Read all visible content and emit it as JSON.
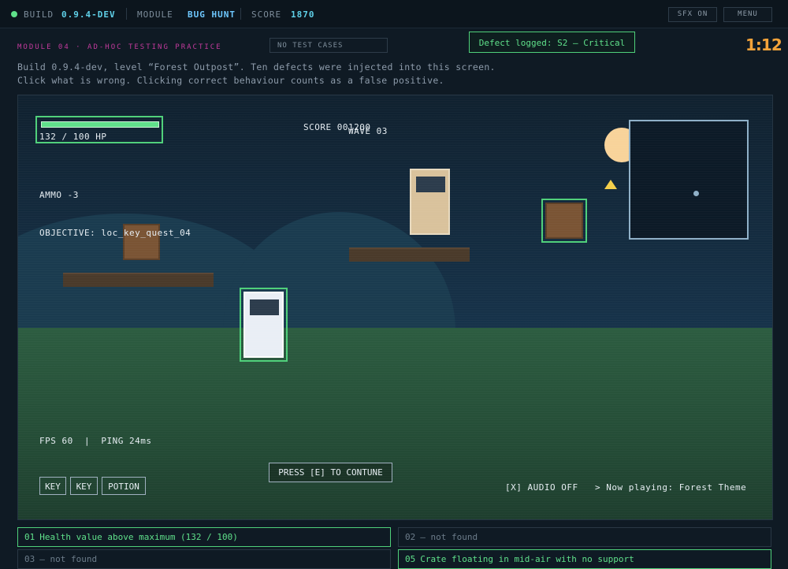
{
  "topbar": {
    "build_label": "BUILD",
    "build_value": "0.9.4-DEV",
    "module_label": "MODULE",
    "module_value": "BUG HUNT",
    "score_label": "SCORE",
    "score_value": "1870",
    "sfx_button": "SFX ON",
    "menu_button": "MENU"
  },
  "header": {
    "module_title": "MODULE 04 · AD-HOC TESTING PRACTICE",
    "test_cases": "NO TEST CASES",
    "toast": "Defect logged: S2 — Critical",
    "timer": "1:12",
    "desc_line1": "Build 0.9.4-dev, level “Forest Outpost”. Ten defects were injected into this screen.",
    "desc_line2": "Click what is wrong. Clicking correct behaviour counts as a false positive."
  },
  "game": {
    "hp_text": "132 / 100 HP",
    "hp_fraction": 1.0,
    "score_text": "SCORE 001200",
    "wave_text": "WAVE 03",
    "ammo_text": "AMMO  -3",
    "objective_text": "OBJECTIVE: loc_key_quest_04",
    "fps_text": "FPS 60  |  PING 24ms",
    "press_prompt": "PRESS [E] TO CONTUNE",
    "audio_text": "[X] AUDIO OFF   > Now playing: Forest Theme",
    "inventory": [
      "KEY",
      "KEY",
      "POTION"
    ]
  },
  "findings": [
    {
      "num": "01",
      "text": "Health value above maximum (132 / 100)",
      "found": true
    },
    {
      "num": "02",
      "text": "— not found",
      "found": false
    },
    {
      "num": "03",
      "text": "— not found",
      "found": false
    },
    {
      "num": "05",
      "text": "Crate floating in mid-air with no support",
      "found": true
    }
  ],
  "colors": {
    "accent_green": "#5fe08a",
    "accent_cyan": "#5fd0e8",
    "timer_orange": "#f2a23a",
    "module_magenta": "#c23a9c"
  }
}
